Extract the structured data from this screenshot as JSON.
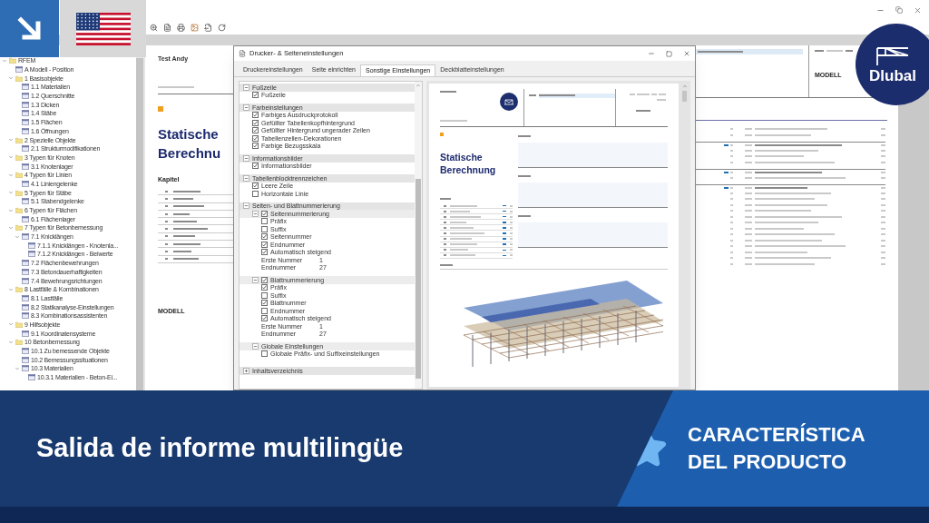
{
  "navigator": {
    "items": [
      {
        "label": "RFEM",
        "kind": "folder",
        "expanded": true,
        "children": [
          {
            "label": "A Modell - Position",
            "kind": "table"
          },
          {
            "label": "1 Basisobjekte",
            "kind": "folder",
            "expanded": true,
            "children": [
              {
                "label": "1.1 Materialien",
                "kind": "table"
              },
              {
                "label": "1.2 Querschnitte",
                "kind": "table"
              },
              {
                "label": "1.3 Dicken",
                "kind": "table"
              },
              {
                "label": "1.4 Stäbe",
                "kind": "table"
              },
              {
                "label": "1.5 Flächen",
                "kind": "table"
              },
              {
                "label": "1.6 Öffnungen",
                "kind": "table"
              }
            ]
          },
          {
            "label": "2 Spezielle Objekte",
            "kind": "folder",
            "expanded": true,
            "children": [
              {
                "label": "2.1 Strukturmodifikationen",
                "kind": "table"
              }
            ]
          },
          {
            "label": "3 Typen für Knoten",
            "kind": "folder",
            "expanded": true,
            "children": [
              {
                "label": "3.1 Knotenlager",
                "kind": "table"
              }
            ]
          },
          {
            "label": "4 Typen für Linien",
            "kind": "folder",
            "expanded": true,
            "children": [
              {
                "label": "4.1 Liniengelenke",
                "kind": "table"
              }
            ]
          },
          {
            "label": "5 Typen für Stäbe",
            "kind": "folder",
            "expanded": true,
            "children": [
              {
                "label": "5.1 Stabendgelenke",
                "kind": "table"
              }
            ]
          },
          {
            "label": "6 Typen für Flächen",
            "kind": "folder",
            "expanded": true,
            "children": [
              {
                "label": "6.1 Flächenlager",
                "kind": "table"
              }
            ]
          },
          {
            "label": "7 Typen für Betonbemessung",
            "kind": "folder",
            "expanded": true,
            "children": [
              {
                "label": "7.1 Knicklängen",
                "kind": "table",
                "expanded": true,
                "children": [
                  {
                    "label": "7.1.1 Knicklängen - Knotenla...",
                    "kind": "table"
                  },
                  {
                    "label": "7.1.2 Knicklängen - Beiwerte",
                    "kind": "table"
                  }
                ]
              },
              {
                "label": "7.2 Flächenbewehrungen",
                "kind": "table"
              },
              {
                "label": "7.3 Betondauerhaftigkeiten",
                "kind": "table"
              },
              {
                "label": "7.4 Bewehrungsrichtungen",
                "kind": "table"
              }
            ]
          },
          {
            "label": "8 Lastfälle & Kombinationen",
            "kind": "folder",
            "expanded": true,
            "children": [
              {
                "label": "8.1 Lastfälle",
                "kind": "table"
              },
              {
                "label": "8.2 Statikanalyse-Einstellungen",
                "kind": "table"
              },
              {
                "label": "8.3 Kombinationsassistenten",
                "kind": "table"
              }
            ]
          },
          {
            "label": "9 Hilfsobjekte",
            "kind": "folder",
            "expanded": true,
            "children": [
              {
                "label": "9.1 Koordinatensysteme",
                "kind": "table"
              }
            ]
          },
          {
            "label": "10 Betonbemessung",
            "kind": "folder",
            "expanded": true,
            "children": [
              {
                "label": "10.1 Zu bemessende Objekte",
                "kind": "table"
              },
              {
                "label": "10.2 Bemessungssituationen",
                "kind": "table"
              },
              {
                "label": "10.3 Materialien",
                "kind": "table",
                "expanded": true,
                "children": [
                  {
                    "label": "10.3.1 Materialien - Beton-Ei...",
                    "kind": "table"
                  }
                ]
              }
            ]
          }
        ]
      }
    ]
  },
  "report_page": {
    "author": "Test Andy",
    "title_lines": [
      "Statische",
      "Berechnu"
    ],
    "chapters_heading": "Kapitel",
    "model_heading": "MODELL",
    "section": "MODELL"
  },
  "dialog": {
    "title": "Drucker- & Seiteneinstellungen",
    "tabs": [
      {
        "label": "Druckereinstellungen",
        "selected": false
      },
      {
        "label": "Seite einrichten",
        "selected": false
      },
      {
        "label": "Sonstige Einstellungen",
        "selected": true
      },
      {
        "label": "Deckblatteinstellungen",
        "selected": false
      }
    ],
    "sections": [
      {
        "label": "Fußzeile",
        "expanded": true,
        "items": [
          {
            "kind": "check",
            "label": "Fußzeile",
            "checked": true
          }
        ]
      },
      {
        "label": "Farbeinstellungen",
        "expanded": true,
        "items": [
          {
            "kind": "check",
            "label": "Farbiges Ausdruckprotokoll",
            "checked": true
          },
          {
            "kind": "check",
            "label": "Gefüllter Tabellenkopfhintergrund",
            "checked": true
          },
          {
            "kind": "check",
            "label": "Gefüllter Hintergrund ungerader Zeilen",
            "checked": true
          },
          {
            "kind": "check",
            "label": "Tabellenzellen-Dekorationen",
            "checked": true
          },
          {
            "kind": "check",
            "label": "Farbige Bezugsskala",
            "checked": true
          }
        ]
      },
      {
        "label": "Informationsbilder",
        "expanded": true,
        "items": [
          {
            "kind": "check",
            "label": "Informationsbilder",
            "checked": true
          }
        ]
      },
      {
        "label": "Tabellenblocktrennzeichen",
        "expanded": true,
        "items": [
          {
            "kind": "check",
            "label": "Leere Zeile",
            "checked": true
          },
          {
            "kind": "check",
            "label": "Horizontale Linie",
            "checked": false
          }
        ]
      },
      {
        "label": "Seiten- und Blattnummerierung",
        "expanded": true,
        "items": [
          {
            "kind": "group",
            "label": "Seitennummerierung",
            "checked": true,
            "expanded": true,
            "items": [
              {
                "kind": "check",
                "label": "Präfix",
                "checked": false
              },
              {
                "kind": "check",
                "label": "Suffix",
                "checked": false
              },
              {
                "kind": "check",
                "label": "Seitennummer",
                "checked": true
              },
              {
                "kind": "check",
                "label": "Endnummer",
                "checked": true
              },
              {
                "kind": "check",
                "label": "Automatisch steigend",
                "checked": true
              },
              {
                "kind": "field",
                "label": "Erste Nummer",
                "value": "1"
              },
              {
                "kind": "field",
                "label": "Endnummer",
                "value": "27"
              }
            ]
          },
          {
            "kind": "group",
            "label": "Blattnummerierung",
            "checked": true,
            "expanded": true,
            "items": [
              {
                "kind": "check",
                "label": "Präfix",
                "checked": true
              },
              {
                "kind": "check",
                "label": "Suffix",
                "checked": false
              },
              {
                "kind": "check",
                "label": "Blattnummer",
                "checked": true
              },
              {
                "kind": "check",
                "label": "Endnummer",
                "checked": false
              },
              {
                "kind": "check",
                "label": "Automatisch steigend",
                "checked": true
              },
              {
                "kind": "field",
                "label": "Erste Nummer",
                "value": "1"
              },
              {
                "kind": "field",
                "label": "Endnummer",
                "value": "27"
              }
            ]
          },
          {
            "kind": "subsection",
            "label": "Globale Einstellungen",
            "expanded": true,
            "items": [
              {
                "kind": "check",
                "label": "Globale Präfix- und Suffixeinstellungen",
                "checked": false
              }
            ]
          }
        ]
      },
      {
        "label": "Inhaltsverzeichnis",
        "expanded": false
      }
    ],
    "preview": {
      "title_lines": [
        "Statische",
        "Berechnung"
      ]
    }
  },
  "banner": {
    "headline": "Salida de informe multilingüe",
    "tag_lines": [
      "CARACTERÍSTICA",
      "DEL PRODUCTO"
    ]
  },
  "logo": {
    "text": "Dlubal"
  }
}
